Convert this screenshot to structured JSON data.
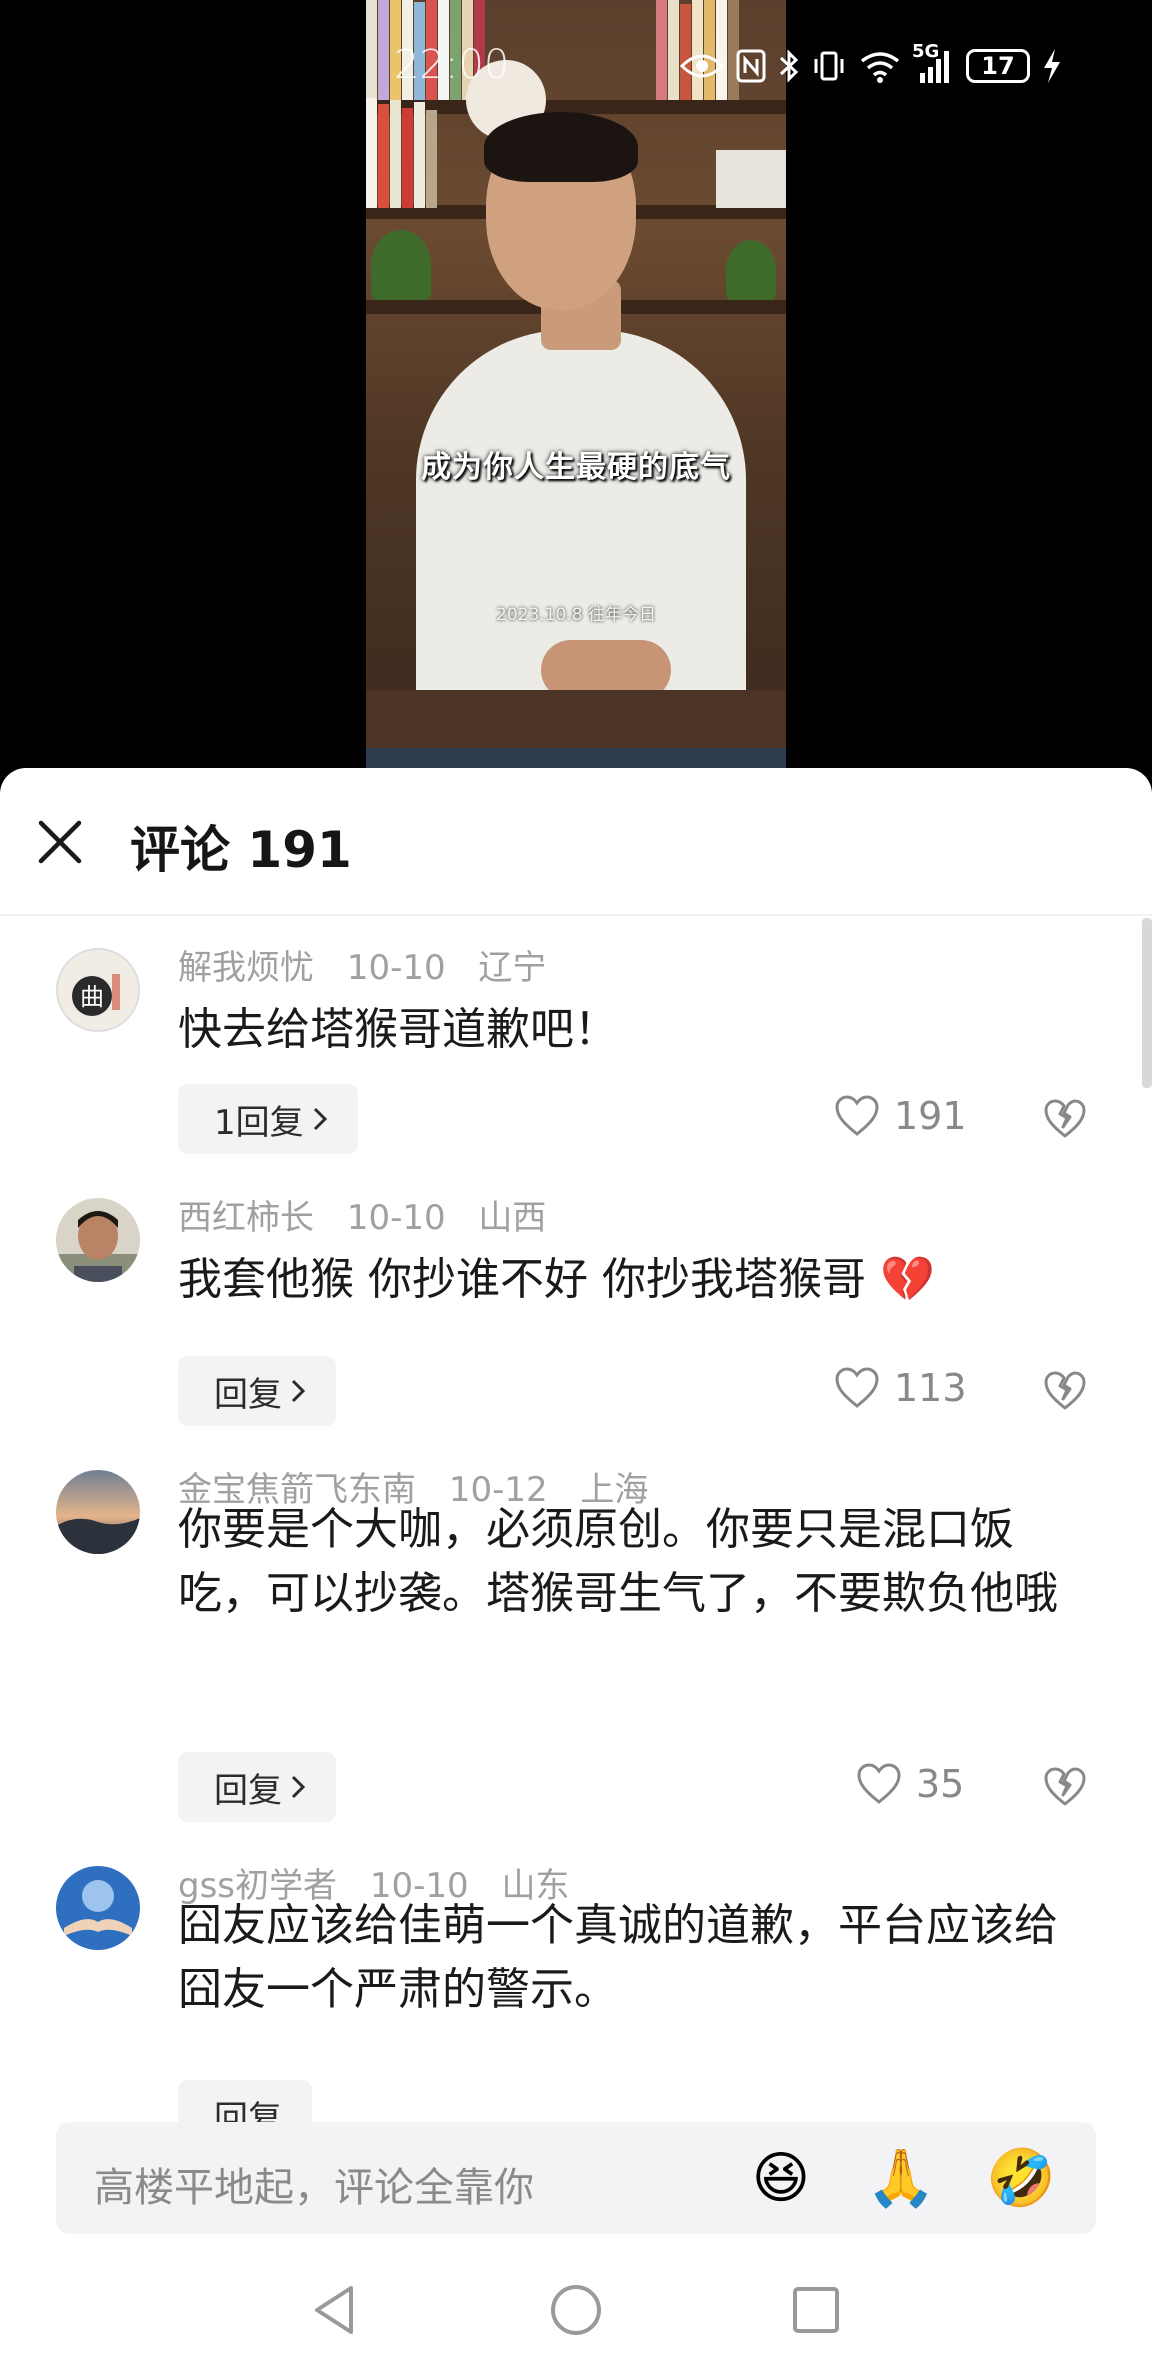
{
  "status_bar": {
    "time": "22:00",
    "network": "5G",
    "battery": "17"
  },
  "video": {
    "subtitle": "成为你人生最硬的底气",
    "date_caption": "2023.10.8 往年今日"
  },
  "sheet": {
    "title": "评论 191"
  },
  "comments": [
    {
      "user": "解我烦忧",
      "date": "10-10",
      "location": "辽宁",
      "text": "快去给塔猴哥道歉吧！",
      "reply_label": "1回复",
      "likes": "191",
      "avatar_icon": "calligraphy-avatar"
    },
    {
      "user": "西红柿长",
      "date": "10-10",
      "location": "山西",
      "text": "我套他猴 你抄谁不好 你抄我塔猴哥 💔",
      "reply_label": "回复",
      "likes": "113",
      "avatar_icon": "photo-avatar"
    },
    {
      "user": "金宝焦箭飞东南",
      "date": "10-12",
      "location": "上海",
      "text": "你要是个大咖，必须原创。你要只是混口饭吃，可以抄袭。塔猴哥生气了，不要欺负他哦",
      "reply_label": "回复",
      "likes": "35",
      "avatar_icon": "landscape-avatar"
    },
    {
      "user": "gss初学者",
      "date": "10-10",
      "location": "山东",
      "text": "囧友应该给佳萌一个真诚的道歉，平台应该给囧友一个严肃的警示。",
      "reply_label": "回复",
      "likes": "",
      "avatar_icon": "hands-avatar"
    }
  ],
  "input_bar": {
    "placeholder": "高楼平地起，评论全靠你",
    "emojis": [
      "😆",
      "🙏",
      "🤣"
    ]
  },
  "colors": {
    "sheet_bg": "#ffffff",
    "meta_text": "#a0a0a0",
    "body_text": "#1a1a1a",
    "reply_bg": "#f3f3f5"
  }
}
